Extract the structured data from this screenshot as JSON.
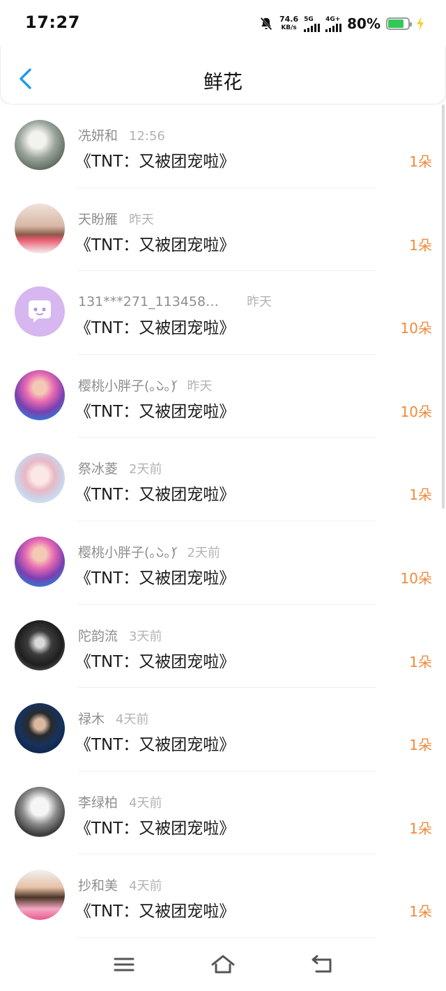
{
  "status_bar": {
    "time": "17:27",
    "net_speed_value": "74.6",
    "net_speed_unit": "KB/s",
    "sim1_label": "5G",
    "sim2_label": "4G+",
    "battery_percent": "80%",
    "battery_level": 0.8,
    "icons": [
      "mute-bell-icon",
      "signal-icon",
      "battery-icon",
      "charging-bolt-icon"
    ]
  },
  "header": {
    "title": "鲜花",
    "back_icon": "chevron-left-icon"
  },
  "colors": {
    "accent_blue": "#1e9bea",
    "amount_orange": "#f08a3a",
    "name_gray": "#8e8e8e",
    "time_gray": "#b3b3b3",
    "battery_green": "#34c759"
  },
  "rows": [
    {
      "name": "冼妍和",
      "time": "12:56",
      "book": "《TNT：又被团宠啦》",
      "amount": "1朵"
    },
    {
      "name": "天盼雁",
      "time": "昨天",
      "book": "《TNT：又被团宠啦》",
      "amount": "1朵"
    },
    {
      "name": "131***271_113458…",
      "time": "昨天",
      "book": "《TNT：又被团宠啦》",
      "amount": "10朵"
    },
    {
      "name": "樱桃小胖子(｡̀ᴗ｡́)",
      "time": "昨天",
      "book": "《TNT：又被团宠啦》",
      "amount": "10朵"
    },
    {
      "name": "祭冰菱",
      "time": "2天前",
      "book": "《TNT：又被团宠啦》",
      "amount": "1朵"
    },
    {
      "name": "樱桃小胖子(｡̀ᴗ｡́)",
      "time": "2天前",
      "book": "《TNT：又被团宠啦》",
      "amount": "10朵"
    },
    {
      "name": "陀韵流",
      "time": "3天前",
      "book": "《TNT：又被团宠啦》",
      "amount": "1朵"
    },
    {
      "name": "禄木",
      "time": "4天前",
      "book": "《TNT：又被团宠啦》",
      "amount": "1朵"
    },
    {
      "name": "李绿柏",
      "time": "4天前",
      "book": "《TNT：又被团宠啦》",
      "amount": "1朵"
    },
    {
      "name": "抄和美",
      "time": "4天前",
      "book": "《TNT：又被团宠啦》",
      "amount": "1朵"
    }
  ],
  "nav": {
    "icons": [
      "menu-icon",
      "home-icon",
      "back-icon"
    ]
  }
}
